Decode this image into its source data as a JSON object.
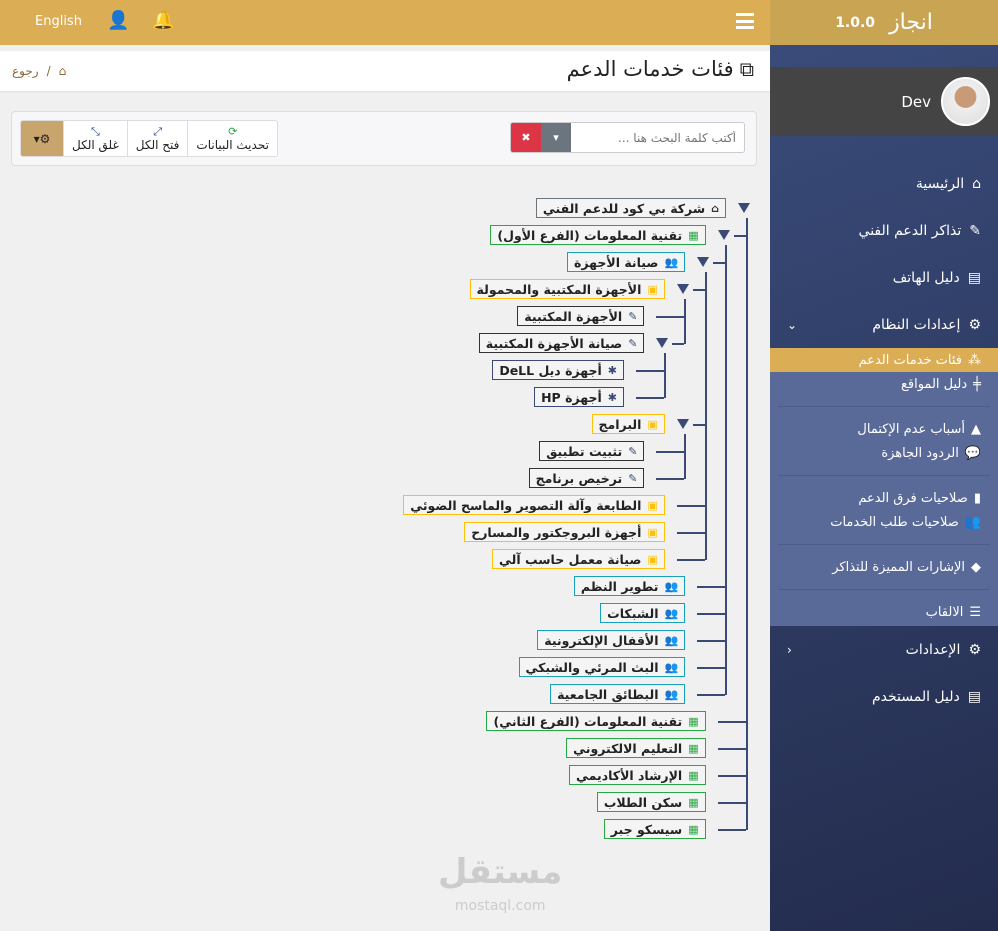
{
  "topbar": {
    "language": "English",
    "icons": [
      "user-icon",
      "bell-icon",
      "menu-icon"
    ]
  },
  "header": {
    "title": "فئات خدمات الدعم",
    "breadcrumb": {
      "home_icon": "home-icon",
      "separator": "/",
      "back": "رجوع"
    }
  },
  "toolbar": {
    "search_placeholder": "أكتب كلمة البحث هنا ...",
    "refresh": "تحديث البيانات",
    "expand_all": "فتح الكل",
    "collapse_all": "غلق الكل"
  },
  "colors": {
    "accent": "#dbad55",
    "navy": "#3a4a75",
    "green": "#28a745",
    "teal": "#17a2b8",
    "yellow": "#ffc107",
    "dark": "#333333",
    "gray": "#6c757d",
    "danger": "#dc3545"
  },
  "tree": {
    "label": "شركة بي كود للدعم الفني",
    "type": "gray",
    "icon": "⌂",
    "children": [
      {
        "label": "تقنية المعلومات (الفرع الأول)",
        "type": "green",
        "icon": "▦",
        "children": [
          {
            "label": "صيانة الأجهزة",
            "type": "teal",
            "icon": "👥",
            "children": [
              {
                "label": "الأجهزة المكتبية والمحمولة",
                "type": "yellow",
                "icon": "▣",
                "children": [
                  {
                    "label": "الأجهزة المكتبية",
                    "type": "dark",
                    "icon": "✎"
                  },
                  {
                    "label": "صيانة الأجهزة المكتبية",
                    "type": "dark",
                    "icon": "✎",
                    "children": [
                      {
                        "label": "أجهزة ديل DeLL",
                        "type": "navy",
                        "icon": "✱"
                      },
                      {
                        "label": "أجهزة HP",
                        "type": "navy",
                        "icon": "✱"
                      }
                    ]
                  }
                ]
              },
              {
                "label": "البرامج",
                "type": "yellow",
                "icon": "▣",
                "children": [
                  {
                    "label": "تثبيت تطبيق",
                    "type": "dark",
                    "icon": "✎"
                  },
                  {
                    "label": "ترخيص برنامج",
                    "type": "dark",
                    "icon": "✎"
                  }
                ]
              },
              {
                "label": "الطابعة وآلة التصوير والماسح الضوئي",
                "type": "yellow",
                "icon": "▣"
              },
              {
                "label": "أجهزة البروجكتور والمسارح",
                "type": "yellow",
                "icon": "▣"
              },
              {
                "label": "صيانة معمل حاسب آلي",
                "type": "yellow",
                "icon": "▣"
              }
            ]
          },
          {
            "label": "تطوير النظم",
            "type": "teal",
            "icon": "👥"
          },
          {
            "label": "الشبكات",
            "type": "teal",
            "icon": "👥"
          },
          {
            "label": "الأقفال الإلكترونية",
            "type": "teal",
            "icon": "👥"
          },
          {
            "label": "البث المرئي والشبكي",
            "type": "teal",
            "icon": "👥"
          },
          {
            "label": "البطائق الجامعية",
            "type": "teal",
            "icon": "👥"
          }
        ]
      },
      {
        "label": "تقنية المعلومات (الفرع الثاني)",
        "type": "green",
        "icon": "▦"
      },
      {
        "label": "التعليم الالكتروني",
        "type": "green",
        "icon": "▦"
      },
      {
        "label": "الإرشاد الأكاديمي",
        "type": "green",
        "icon": "▦"
      },
      {
        "label": "سكن الطلاب",
        "type": "green",
        "icon": "▦"
      },
      {
        "label": "سيسكو جبر",
        "type": "green",
        "icon": "▦"
      }
    ]
  },
  "sidebar": {
    "brand": "انجاز",
    "version": "1.0.0",
    "user": "Dev",
    "items": [
      {
        "label": "الرئيسية",
        "icon": "⌂"
      },
      {
        "label": "تذاكر الدعم الفني",
        "icon": "✎"
      },
      {
        "label": "دليل الهاتف",
        "icon": "▤"
      },
      {
        "label": "إعدادات النظام",
        "icon": "⚙",
        "chevron": "⌄"
      }
    ],
    "sub": [
      {
        "label": "فئات خدمات الدعم",
        "icon": "⁂"
      },
      {
        "label": "دليل المواقع",
        "icon": "╪"
      },
      {
        "label": "أسباب عدم الإكتمال",
        "icon": "▲"
      },
      {
        "label": "الردود الجاهزة",
        "icon": "💬"
      },
      {
        "label": "صلاحيات فرق الدعم",
        "icon": "▮"
      },
      {
        "label": "صلاحيات طلب الخدمات",
        "icon": "👥"
      },
      {
        "label": "الإشارات المميزة للتذاكر",
        "icon": "◆"
      },
      {
        "label": "الالقاب",
        "icon": "☰"
      }
    ],
    "bottom": [
      {
        "label": "الإعدادات",
        "icon": "⚙",
        "chevron": "‹"
      },
      {
        "label": "دليل المستخدم",
        "icon": "▤"
      }
    ]
  },
  "watermark": {
    "text": "مستقل",
    "url": "mostaql.com"
  }
}
